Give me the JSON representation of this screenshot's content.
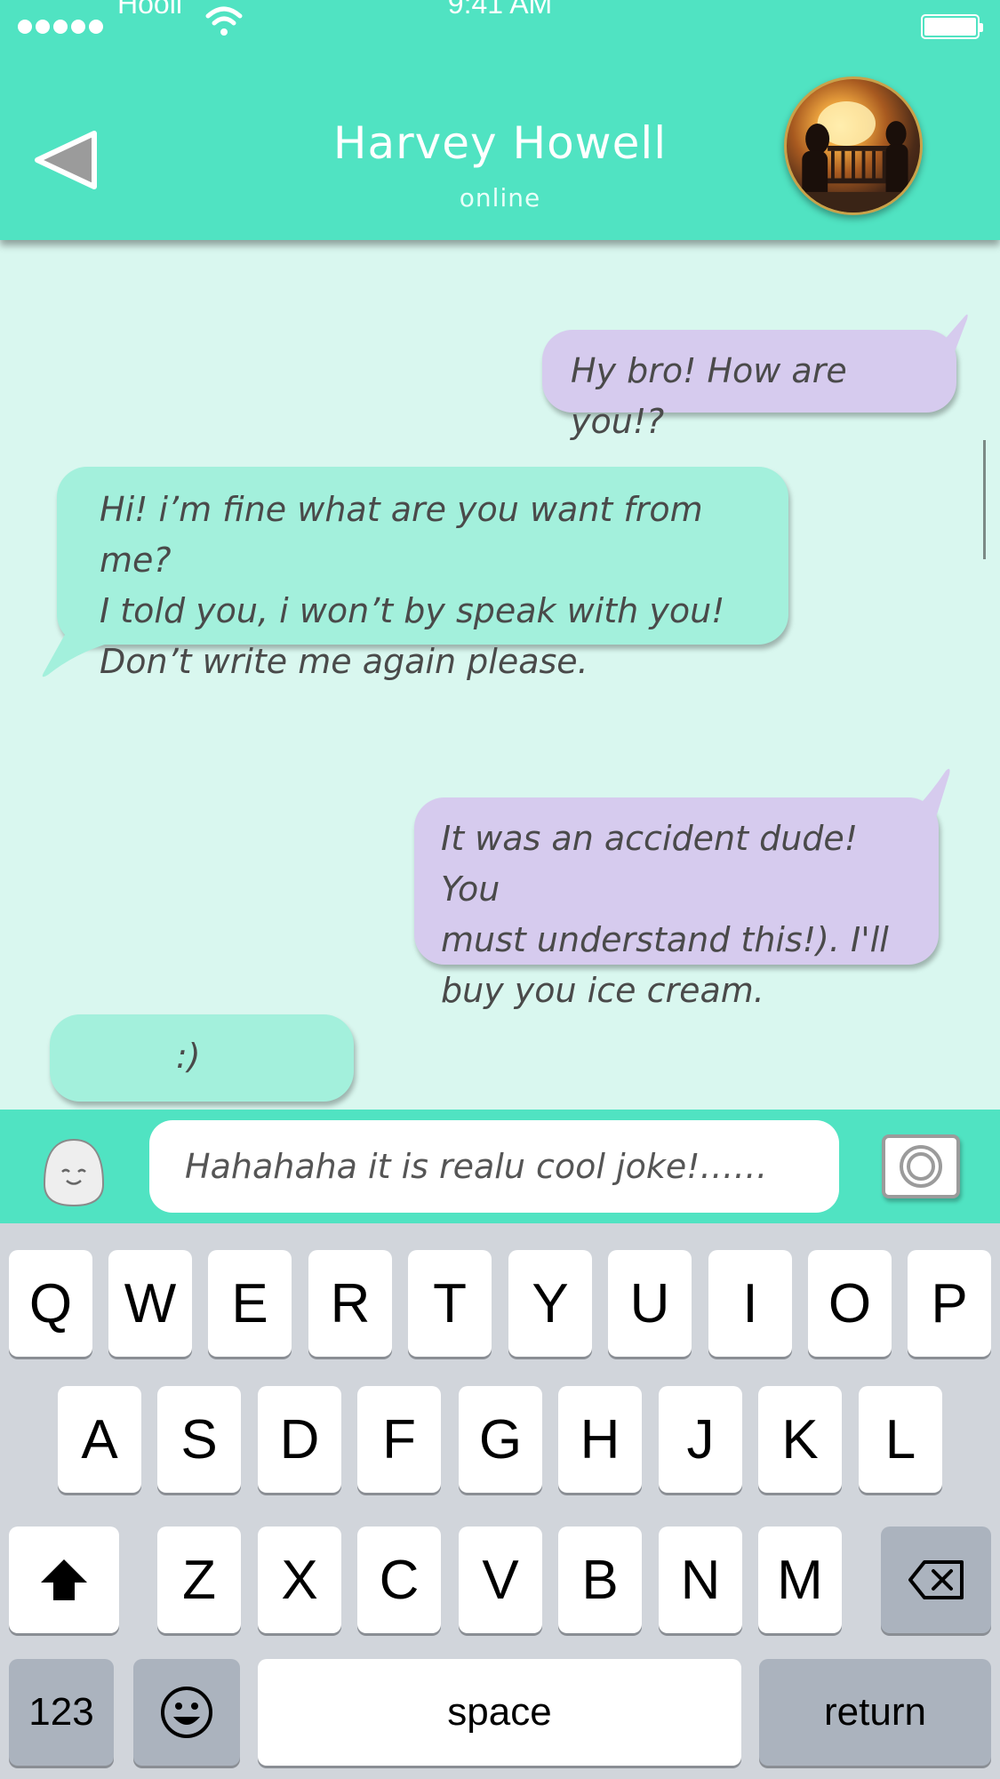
{
  "status_bar": {
    "carrier": "Hooli",
    "time": "9:41 AM"
  },
  "header": {
    "contact_name": "Harvey Howell",
    "contact_status": "online"
  },
  "messages": [
    {
      "direction": "outgoing",
      "lines": [
        "Hy bro! How are you!?"
      ]
    },
    {
      "direction": "incoming",
      "lines": [
        "Hi! i’m fine what are you want from me?",
        "I told you, i won’t by speak with you!",
        "Don’t write me again please."
      ]
    },
    {
      "direction": "outgoing",
      "lines": [
        "It was an accident dude! You",
        "must understand this!). I'll",
        "buy you ice cream."
      ]
    },
    {
      "direction": "incoming",
      "lines": [
        ":)"
      ]
    }
  ],
  "composer": {
    "input_value": "Hahahaha it is realu cool joke!……"
  },
  "keyboard": {
    "row1": [
      "Q",
      "W",
      "E",
      "R",
      "T",
      "Y",
      "U",
      "I",
      "O",
      "P"
    ],
    "row2": [
      "A",
      "S",
      "D",
      "F",
      "G",
      "H",
      "J",
      "K",
      "L"
    ],
    "row3": [
      "Z",
      "X",
      "C",
      "V",
      "B",
      "N",
      "M"
    ],
    "numbers_label": "123",
    "space_label": "space",
    "return_label": "return"
  },
  "colors": {
    "accent": "#50e3c2",
    "chat_background": "#d9f7ef",
    "outgoing_bubble": "#d6cbee",
    "incoming_bubble": "#a3f0dc",
    "keyboard_background": "#d1d5db"
  },
  "icons": [
    "signal-dots-icon",
    "wifi-icon",
    "battery-icon",
    "back-arrow-icon",
    "sticker-icon",
    "camera-icon",
    "shift-icon",
    "backspace-icon",
    "emoji-icon"
  ]
}
